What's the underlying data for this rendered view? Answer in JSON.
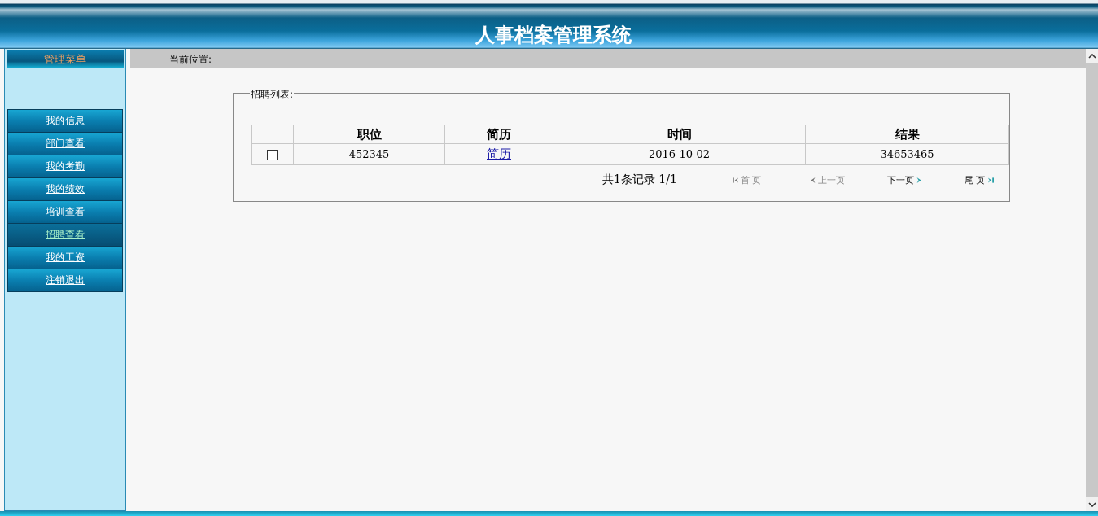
{
  "header": {
    "title": "人事档案管理系统"
  },
  "sidebar": {
    "title": "管理菜单",
    "items": [
      {
        "label": "我的信息",
        "selected": false
      },
      {
        "label": "部门查看",
        "selected": false
      },
      {
        "label": "我的考勤",
        "selected": false
      },
      {
        "label": "我的绩效",
        "selected": false
      },
      {
        "label": "培训查看",
        "selected": false
      },
      {
        "label": "招聘查看",
        "selected": true
      },
      {
        "label": "我的工资",
        "selected": false
      },
      {
        "label": "注销退出",
        "selected": false
      }
    ]
  },
  "breadcrumb": {
    "label": "当前位置:"
  },
  "panel": {
    "legend": "招聘列表:",
    "table": {
      "columns": [
        "职位",
        "简历",
        "时间",
        "结果"
      ],
      "rows": [
        {
          "checked": false,
          "cells": [
            "452345",
            "简历",
            "2016-10-02",
            "34653465"
          ]
        }
      ]
    },
    "pager": {
      "summary": "共1条记录  1/1",
      "links": [
        {
          "kind": "first",
          "label": "首 页",
          "disabled": true
        },
        {
          "kind": "prev",
          "label": "上一页",
          "disabled": true
        },
        {
          "kind": "next",
          "label": "下一页",
          "disabled": false
        },
        {
          "kind": "last",
          "label": "尾 页",
          "disabled": false
        }
      ]
    }
  }
}
